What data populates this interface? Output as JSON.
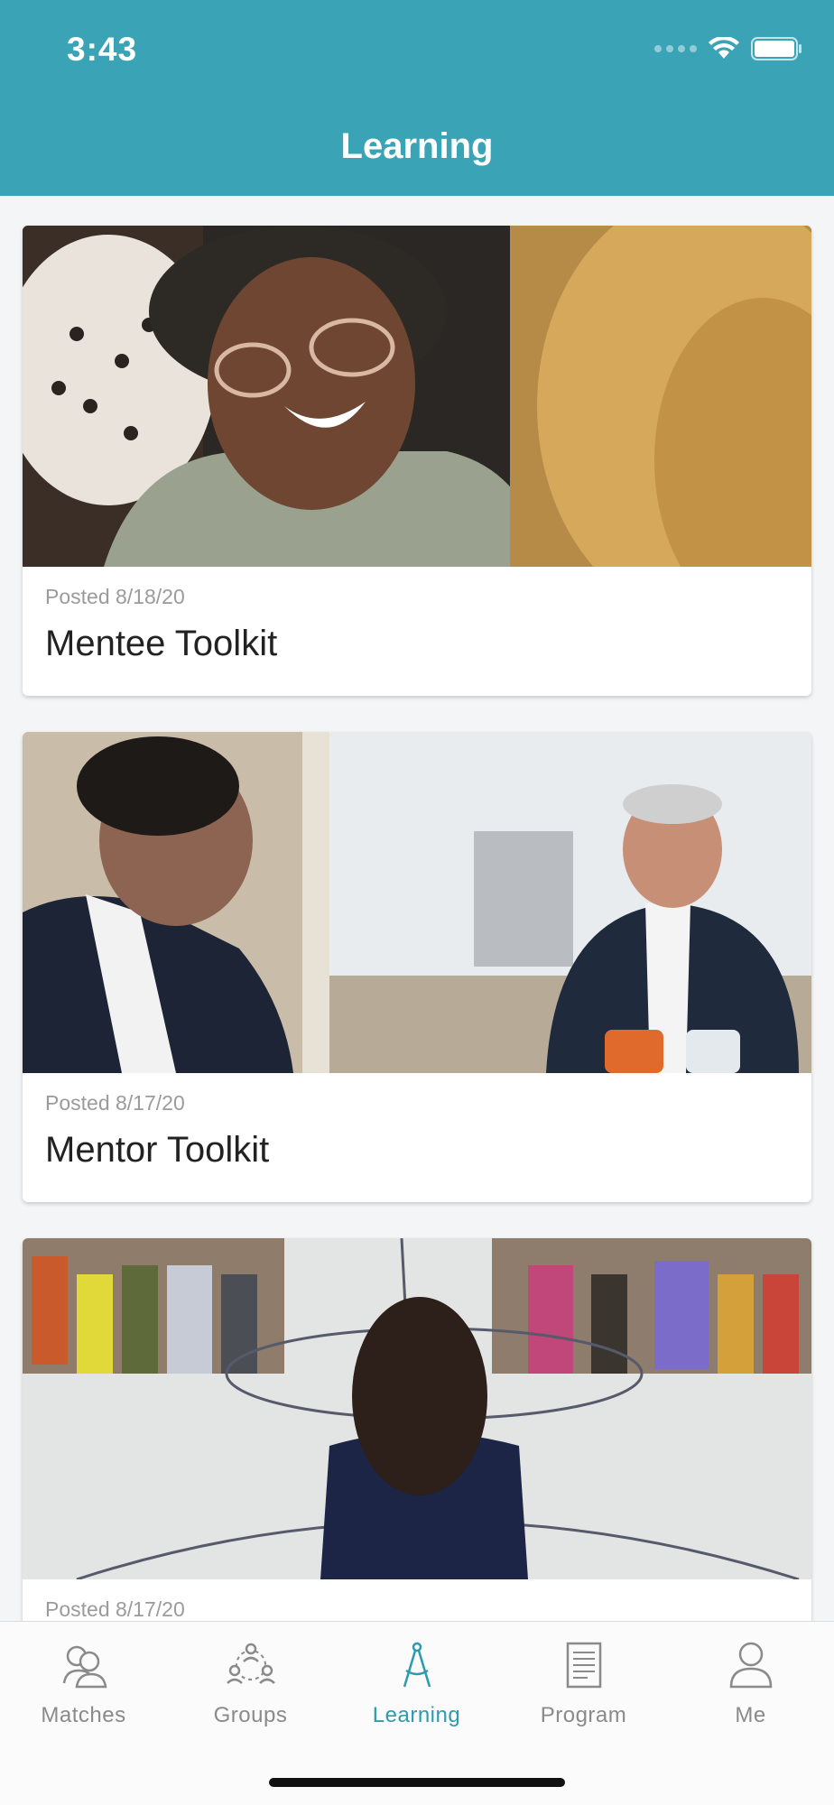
{
  "status_bar": {
    "time": "3:43"
  },
  "header": {
    "title": "Learning"
  },
  "colors": {
    "accent": "#3aa3b5",
    "tab_active": "#2e9aad",
    "tab_inactive": "#8a8a8a"
  },
  "cards": [
    {
      "posted": "Posted 8/18/20",
      "title": "Mentee Toolkit",
      "image": "photo-smiling-woman-glasses"
    },
    {
      "posted": "Posted 8/17/20",
      "title": "Mentor Toolkit",
      "image": "photo-two-men-meeting"
    },
    {
      "posted": "Posted 8/17/20",
      "title": "",
      "image": "photo-speaker-gymnasium-audience"
    }
  ],
  "tabs": [
    {
      "label": "Matches",
      "icon": "matches-icon",
      "active": false
    },
    {
      "label": "Groups",
      "icon": "groups-icon",
      "active": false
    },
    {
      "label": "Learning",
      "icon": "compass-icon",
      "active": true
    },
    {
      "label": "Program",
      "icon": "document-icon",
      "active": false
    },
    {
      "label": "Me",
      "icon": "person-icon",
      "active": false
    }
  ]
}
